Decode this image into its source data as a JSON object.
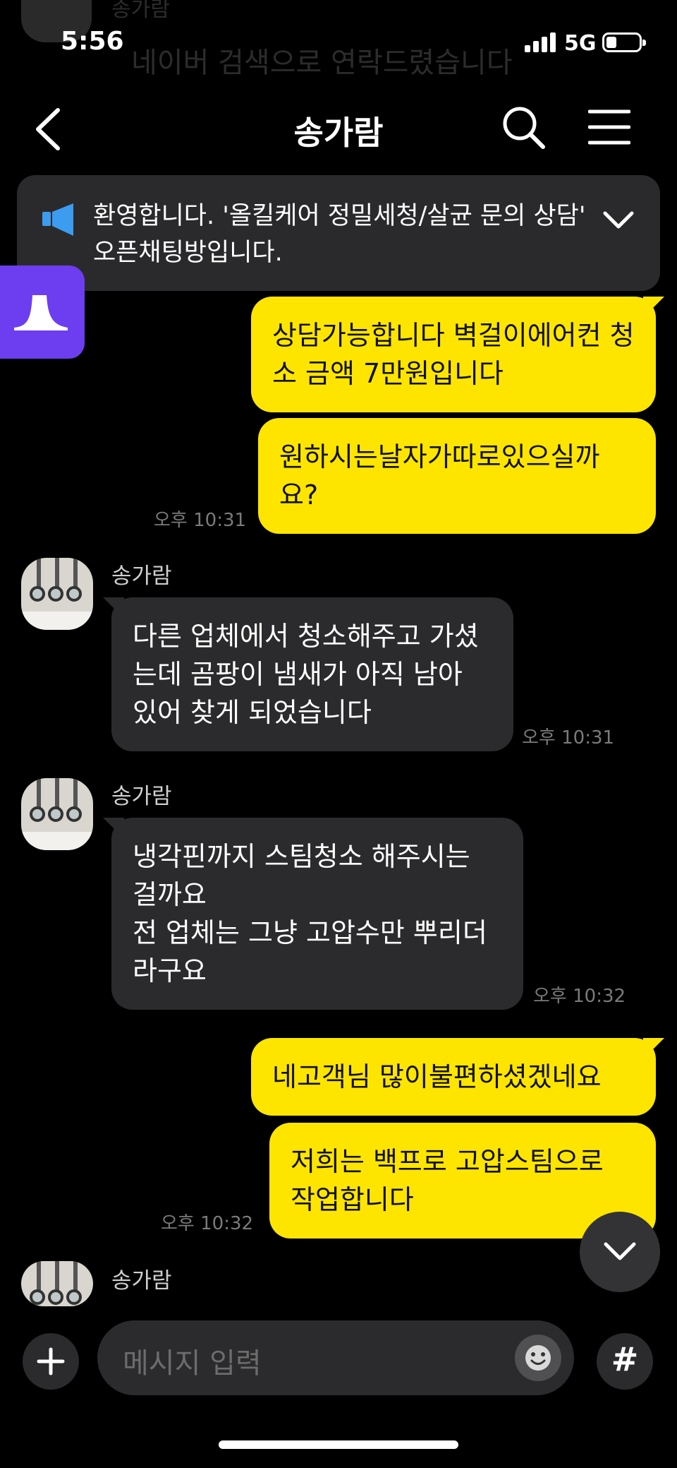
{
  "status": {
    "time": "5:56",
    "network": "5G"
  },
  "ghost": {
    "sender": "송가람",
    "text": "네이버 검색으로 연락드렸습니다"
  },
  "header": {
    "title": "송가람"
  },
  "notice": {
    "text": "환영합니다. '올킬케어 정밀세청/살균 문의 상담' 오픈채팅방입니다."
  },
  "messages": {
    "m1": "상담가능합니다 벽걸이에어컨 청소 금액 7만원입니다",
    "m2": "원하시는날자가따로있으실까요?",
    "t2": "오후 10:31",
    "s3": "송가람",
    "m3": "다른 업체에서 청소해주고 가셨는데 곰팡이 냄새가 아직 남아 있어 찾게 되었습니다",
    "t3": "오후 10:31",
    "s4": "송가람",
    "m4a": "냉각핀까지 스팀청소 해주시는 걸까요",
    "m4b": "전 업체는 그냥 고압수만 뿌리더라구요",
    "t4": "오후 10:32",
    "m5": "네고객님 많이불편하셨겠네요",
    "m6": "저희는 백프로 고압스팀으로 작업합니다",
    "t6": "오후 10:32",
    "s7": "송가람"
  },
  "input": {
    "placeholder": "메시지 입력",
    "hash": "#"
  },
  "colors": {
    "outgoing": "#fee500",
    "incoming": "#2b2b2d",
    "side_app": "#6d3df0",
    "notice_icon": "#3b9cf0"
  },
  "icons": [
    "back-arrow-icon",
    "search-icon",
    "menu-icon",
    "megaphone-icon",
    "chevron-down-icon",
    "plus-icon",
    "emoji-icon",
    "hash-icon"
  ]
}
